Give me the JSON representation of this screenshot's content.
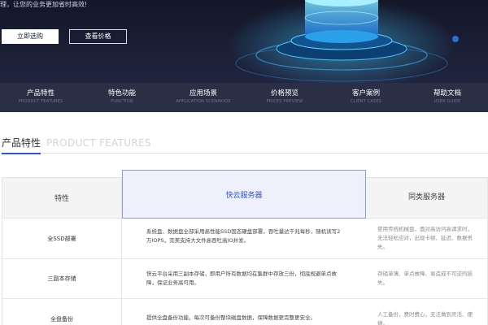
{
  "hero": {
    "tagline": "理，让您的业务更加省时高效!",
    "buy_button": "立即选购",
    "price_button": "查看价格"
  },
  "nav": {
    "items": [
      {
        "label": "产品特性",
        "sub": "PRODUCT FEATURES"
      },
      {
        "label": "特色功能",
        "sub": "FUNCTION"
      },
      {
        "label": "应用场景",
        "sub": "APPLICATION SCENARIOS"
      },
      {
        "label": "价格预览",
        "sub": "PRICES PREVIEW"
      },
      {
        "label": "客户案例",
        "sub": "CLIENT CASES"
      },
      {
        "label": "帮助文档",
        "sub": "USER GUIDE"
      }
    ]
  },
  "section": {
    "title_cn": "产品特性",
    "title_en": "PRODUCT FEATURES"
  },
  "table": {
    "headers": [
      "特性",
      "快云服务器",
      "同类服务器"
    ],
    "rows": [
      {
        "feature": "全SSD部署",
        "ours": "系统盘、数据盘全部采用高性能SSD固态硬盘部署，吞吐量达千兆每秒，随机读写2万IOPS，完美支持大文件高吞吐高IO并发。",
        "others": "使用传统机械盘，面对高访问高请求时，无法轻松应对，出现卡顿、延迟、数据丢失。"
      },
      {
        "feature": "三副本存储",
        "ours": "快云平台采用三副本存储，即用户所有数据均在集群中存放三份，彻底规避单点故障，保证业务高可用。",
        "others": "存储单薄、单点故障、易造成不可逆的损失。"
      },
      {
        "feature": "全盘备份",
        "ours": "提供全盘备份功能，每次可备份整块磁盘数据，保障数据更完整更安全。",
        "others": "人工备份，费时费心，无法做到灵活、便捷。"
      }
    ]
  },
  "colors": {
    "accent": "#2f55d4",
    "hero_bg": "#1b1f36",
    "nav_bg": "#2b2f45"
  }
}
